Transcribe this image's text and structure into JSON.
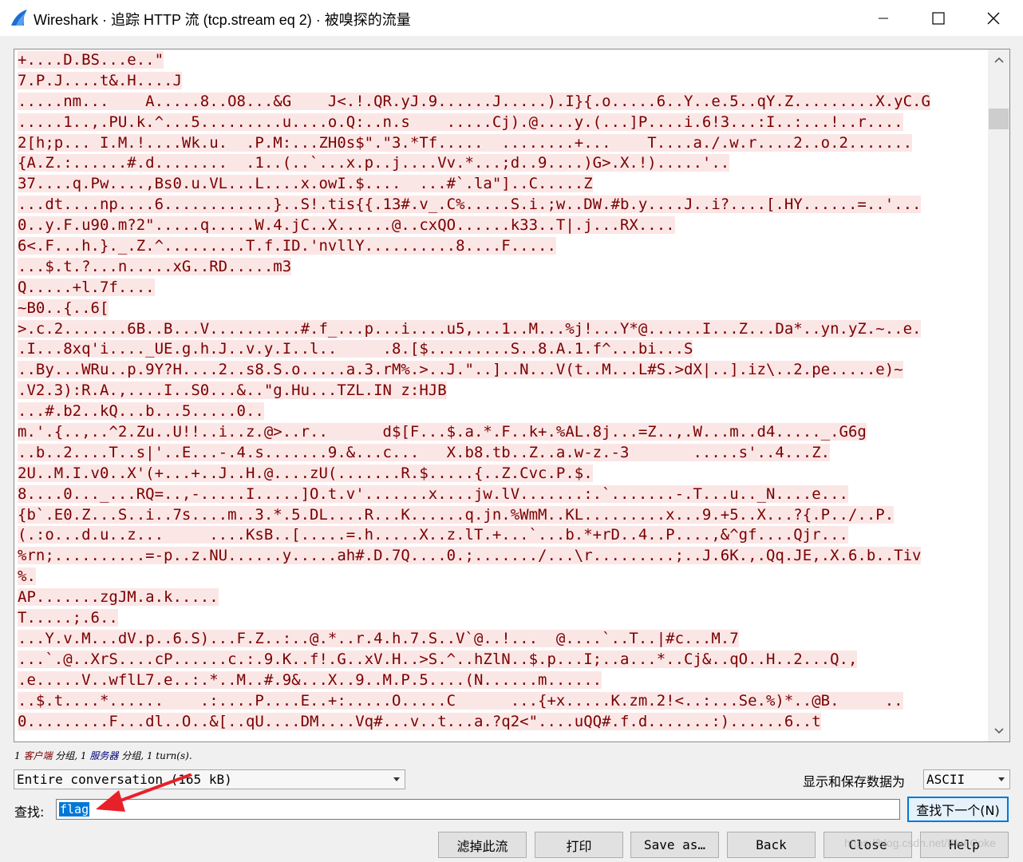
{
  "window": {
    "title": "Wireshark · 追踪 HTTP 流 (tcp.stream eq 2) · 被嗅探的流量",
    "minimize_icon": "minimize-icon",
    "maximize_icon": "maximize-icon",
    "close_icon": "close-icon"
  },
  "stream": {
    "text_color": "#7a0000",
    "highlight_color": "#fbe6e6",
    "lines": [
      "+....D.BS...e..\"",
      "7.P.J....t&.H....J",
      ".....nm...    A.....8..O8...&G    J<.!.QR.yJ.9......J.....).I}{.o.....6..Y..e.5..qY.Z.........X.yC.G",
      ".....1..,.PU.k.^...5.........u....o.Q:..n.s    .....Cj).@....y.(...]P....i.6!3...:I..:...!..r....",
      "2[h;p... I.M.!....Wk.u.  .P.M:...ZH0s$\".\"3.*Tf.....  ........+...    T....a./.w.r....2..o.2.......",
      "{A.Z.:......#.d........  .1..(..`...x.p..j....Vv.*...;d..9....)G>.X.!).....'..",
      "37....q.Pw....,Bs0.u.VL...L....x.owI.$....  ...#`.la\"]..C.....Z",
      "...dt....np....6............}..S!.tis{{.13#.v_.C%.....S.i.;w..DW.#b.y....J..i?....[.HY......=..'...",
      "0..y.F.u90.m?2\".....q.....W.4.jC..X......@..cxQO......k33..T|.j...RX....",
      "6<.F...h.}._.Z.^.........T.f.ID.'nvllY..........8....F.....",
      "...$.t.?...n.....xG..RD.....m3",
      "Q.....+l.7f....",
      "~B0..{..6[",
      ">.c.2.......6B..B...V..........#.f_...p...i....u5,...1..M...%j!...Y*@......I...Z...Da*..yn.yZ.~..e.",
      ".I...8xq'i...._UE.g.h.J..v.y.I..l..     .8.[$.........S..8.A.1.f^...bi...S",
      "..By...WRu..p.9Y?H....2..s8.S.o.....a.3.rM%.>..J.\"..]..N...V(t..M...L#S.>dX|..].iz\\..2.pe.....e)~",
      ".V2.3):R.A.,....I..S0...&..\"g.Hu...TZL.IN z:HJB",
      "...#.b2..kQ...b...5.....0..",
      "m.'.{..,..^2.Zu..U!!..i..z.@>..r..      d$[F...$.a.*.F..k+.%AL.8j...=Z..,.W...m..d4....._.G6g",
      "..b..2....T..s|'..E...-.4.s.......9.&...c...   X.b8.tb..Z..a.w-z.-3       .....s'..4...Z.",
      "2U..M.I.v0..X'(+...+..J..H.@....zU(.......R.$.....{..Z.Cvc.P.$.",
      "8....0..._...RQ=..,-.....I.....]O.t.v'.......x....jw.lV.......:.`.......-.T...u.._N....e...",
      "{b`.E0.Z...S..i..7s....m..3.*.5.DL....R...K......q.jn.%WmM..KL.........x...9.+5..X...?{.P../..P.",
      "(.:o...d.u..z...     ....KsB..[.....=.h.....X..z.lT.+...`...b.*+rD..4..P....,&^gf....Qjr...",
      "%rn;..........=-p..z.NU......y.....ah#.D.7Q....0.;......./...\\r.........;..J.6K.,.Qq.JE,.X.6.b..Tiv",
      "%.",
      "AP.......zgJM.a.k.....",
      "T.....;.6..",
      "...Y.v.M...dV.p..6.S)...F.Z..:..@.*..r.4.h.7.S..V`@..!...  @....`..T..|#c...M.7",
      "...`.@..XrS....cP......c.:.9.K..f!.G..xV.H..>S.^..hZlN..$.p...I;..a...*..Cj&..qO..H..2...Q.,",
      ".e.....V..wflL7.e..:.*..M..#.9&...X..9..M.P.5....(N......m......",
      "..$.t....*......    .:....P....E..+:.....O.....C      ...{+x.....K.zm.2!<..:...Se.%)*..@B.     ..",
      "0.........F...dl..O..&[..qU....DM....Vq#...v..t...a.?q2<\"....uQQ#.f.d.......:)......6..t"
    ]
  },
  "scrollbar": {
    "up_icon": "chevron-up-icon",
    "down_icon": "chevron-down-icon"
  },
  "packet_summary": {
    "part1": "1 ",
    "client": "客户端",
    "part2": " 分组, 1 ",
    "server": "服务器",
    "part3": " 分组, 1 turn(s)."
  },
  "conversation_select": {
    "value": "Entire conversation (165 kB)"
  },
  "format": {
    "label": "显示和保存数据为",
    "value": "ASCII"
  },
  "find": {
    "label": "查找:",
    "value": "flag",
    "next_label": "查找下一个(N)"
  },
  "buttons": {
    "filter_out": "滤掉此流",
    "print": "打印",
    "save_as": "Save as…",
    "back": "Back",
    "close": "Close",
    "help": "Help"
  },
  "colors": {
    "accent": "#0078d7",
    "annotation_arrow": "#e8202a",
    "wireshark_fin": "#1c6fd1"
  },
  "watermark": "https://blog.csdn.net/BlueCoke"
}
